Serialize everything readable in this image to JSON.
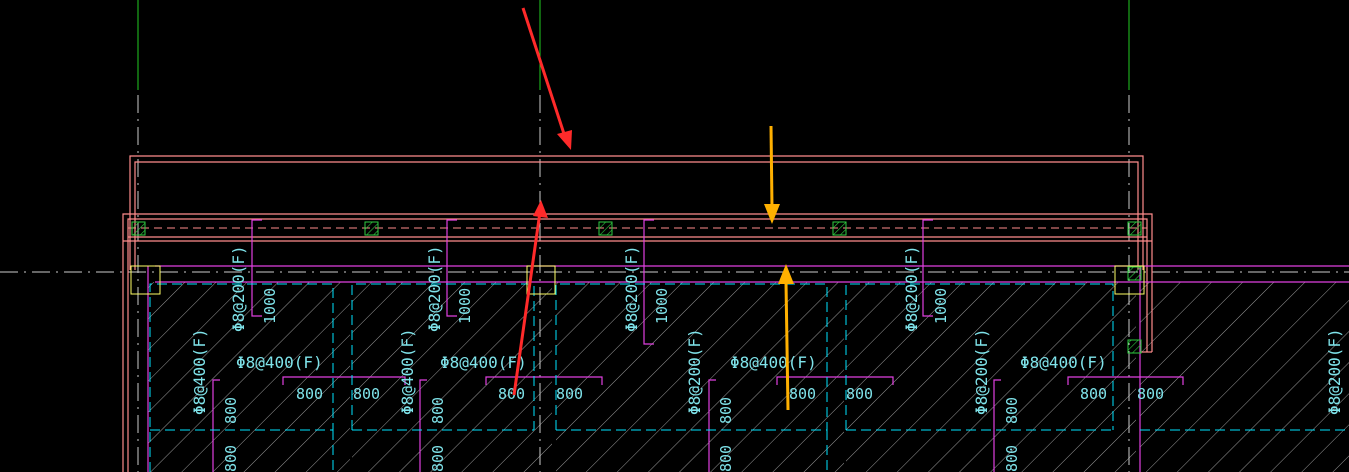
{
  "colors": {
    "background": "#000000",
    "wall_outline": "#ff8c8c",
    "rebar": "#e040e0",
    "dashed": "#00e5ff",
    "axis": "#22cc22",
    "column": "#2ecc40",
    "column_box": "#ffff66",
    "hatch": "#aaaaaa",
    "label": "#7fe3ea",
    "arrow_red": "#ff2a2a",
    "arrow_orange": "#ffb000"
  },
  "drawing": {
    "dist_label_200": "Φ8@200(F)",
    "dist_label_400": "Φ8@400(F)",
    "dim_1000": "1000",
    "dim_800": "800"
  },
  "annotations": {
    "arrow_red": "red-arrow",
    "arrow_orange": "orange-arrow"
  }
}
